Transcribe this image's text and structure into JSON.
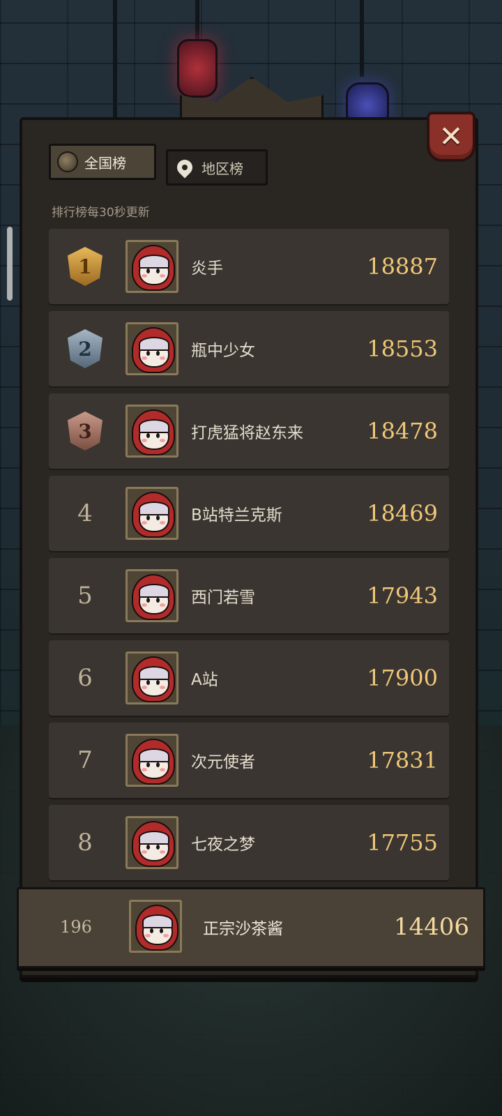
{
  "hint_text": "排行榜每30秒更新",
  "tabs": [
    {
      "label": "全国榜",
      "icon": "globe-icon",
      "active": true
    },
    {
      "label": "地区榜",
      "icon": "location-pin-icon",
      "active": false
    }
  ],
  "close_icon": "close-x-icon",
  "leaderboard": [
    {
      "rank": "1",
      "name": "炎手",
      "score": "18887",
      "medal": "gold"
    },
    {
      "rank": "2",
      "name": "瓶中少女",
      "score": "18553",
      "medal": "silver"
    },
    {
      "rank": "3",
      "name": "打虎猛将赵东来",
      "score": "18478",
      "medal": "bronze"
    },
    {
      "rank": "4",
      "name": "B站特兰克斯",
      "score": "18469"
    },
    {
      "rank": "5",
      "name": "西门若雪",
      "score": "17943"
    },
    {
      "rank": "6",
      "name": "A站",
      "score": "17900"
    },
    {
      "rank": "7",
      "name": "次元使者",
      "score": "17831"
    },
    {
      "rank": "8",
      "name": "七夜之梦",
      "score": "17755"
    }
  ],
  "self": {
    "rank": "196",
    "name": "正宗沙茶酱",
    "score": "14406"
  },
  "colors": {
    "score": "#f0c878",
    "panel": "#2a2622",
    "row": "#3a3531",
    "close": "#8a3028"
  }
}
